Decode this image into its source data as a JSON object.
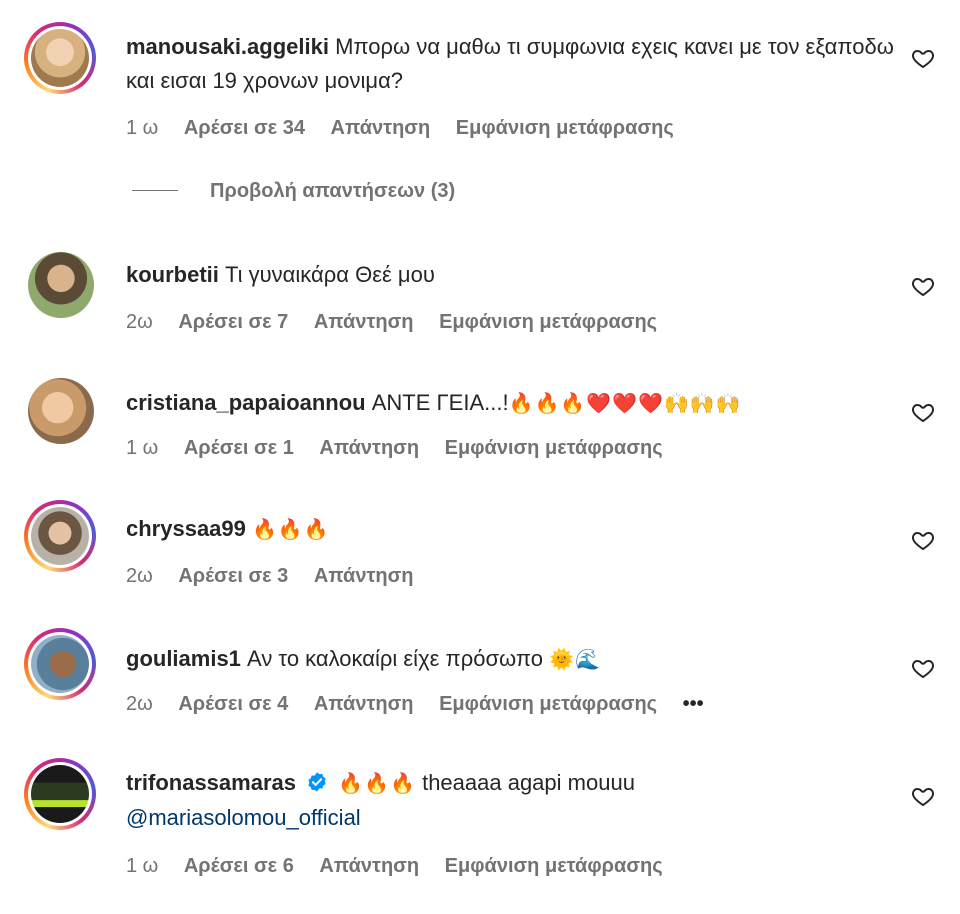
{
  "comments": [
    {
      "username": "manousaki.aggeliki",
      "text": "Μπορω να μαθω τι συμφωνια εχεις κανει με τον εξαποδω και εισαι 19 χρονων μονιμα?",
      "time": "1 ω",
      "likes": "Αρέσει σε 34",
      "reply": "Απάντηση",
      "translate": "Εμφάνιση μετάφρασης"
    },
    {
      "username": "kourbetii",
      "text": "Τι γυναικάρα Θεέ μου",
      "time": "2ω",
      "likes": "Αρέσει σε 7",
      "reply": "Απάντηση",
      "translate": "Εμφάνιση μετάφρασης"
    },
    {
      "username": "cristiana_papaioannou",
      "text": "ΑΝΤΕ ΓΕΙΑ...!",
      "emoji": "🔥🔥🔥❤️❤️❤️🙌🙌🙌",
      "time": "1 ω",
      "likes": "Αρέσει σε 1",
      "reply": "Απάντηση",
      "translate": "Εμφάνιση μετάφρασης"
    },
    {
      "username": "chryssaa99",
      "emoji": "🔥🔥🔥",
      "time": "2ω",
      "likes": "Αρέσει σε 3",
      "reply": "Απάντηση"
    },
    {
      "username": "gouliamis1",
      "text": "Αν το καλοκαίρι είχε πρόσωπο",
      "emoji": "🌞🌊",
      "time": "2ω",
      "likes": "Αρέσει σε 4",
      "reply": "Απάντηση",
      "translate": "Εμφάνιση μετάφρασης",
      "more": "•••"
    },
    {
      "username": "trifonassamaras",
      "emoji": "🔥🔥🔥",
      "text": "theaaaa agapi mouuu",
      "mention": "@mariasolomou_official",
      "time": "1 ω",
      "likes": "Αρέσει σε 6",
      "reply": "Απάντηση",
      "translate": "Εμφάνιση μετάφρασης"
    }
  ],
  "view_replies": "Προβολή απαντήσεων (3)",
  "colors": {
    "secondary": "#737373",
    "mention": "#00376b",
    "verified": "#0095f6"
  }
}
